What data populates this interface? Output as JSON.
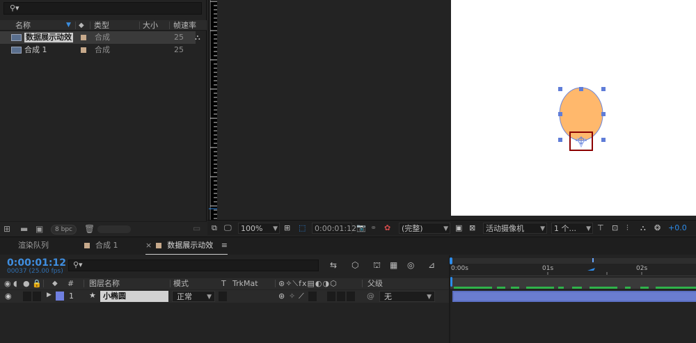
{
  "project": {
    "search_placeholder": "",
    "columns": {
      "name": "名称",
      "type": "类型",
      "size": "大小",
      "fps": "帧速率"
    },
    "items": [
      {
        "name": "数据展示动效",
        "type": "合成",
        "fps": "25",
        "selected": true
      },
      {
        "name": "合成 1",
        "type": "合成",
        "fps": "25",
        "selected": false
      }
    ],
    "footer": {
      "bpc": "8 bpc"
    }
  },
  "viewer": {
    "zoom": "100%",
    "timecode": "0:00:01:12",
    "resolution": "(完整)",
    "camera": "活动摄像机",
    "views": "1 个...",
    "exposure": "+0.0"
  },
  "tabs": [
    {
      "label": "渲染队列"
    },
    {
      "label": "合成 1"
    },
    {
      "label": "数据展示动效",
      "close": "×"
    }
  ],
  "timeline": {
    "timecode": "0:00:01:12",
    "fps": "00037 (25.00 fps)",
    "columns": {
      "num": "#",
      "layer_name": "图层名称",
      "mode": "模式",
      "t": "T",
      "trkmat": "TrkMat",
      "parent": "父级"
    },
    "layers": [
      {
        "num": "1",
        "name": "小椭圆",
        "mode": "正常",
        "parent": "无"
      }
    ],
    "ruler_labels": [
      "0:00s",
      "01s",
      "02s"
    ]
  },
  "colors": {
    "accent": "#2d8ceb",
    "layer_bar": "#5b6fc2",
    "ellipse_fill": "#ffb86c",
    "handle": "#5f7dd8",
    "selection_box": "#8b0000",
    "label": "#c7a98b"
  },
  "icons": [
    "search-icon",
    "composition-icon",
    "label-icon",
    "trash-icon",
    "folder-icon",
    "eye-icon",
    "audio-icon",
    "lock-icon",
    "camera-icon",
    "star-icon",
    "flowchart-icon"
  ]
}
